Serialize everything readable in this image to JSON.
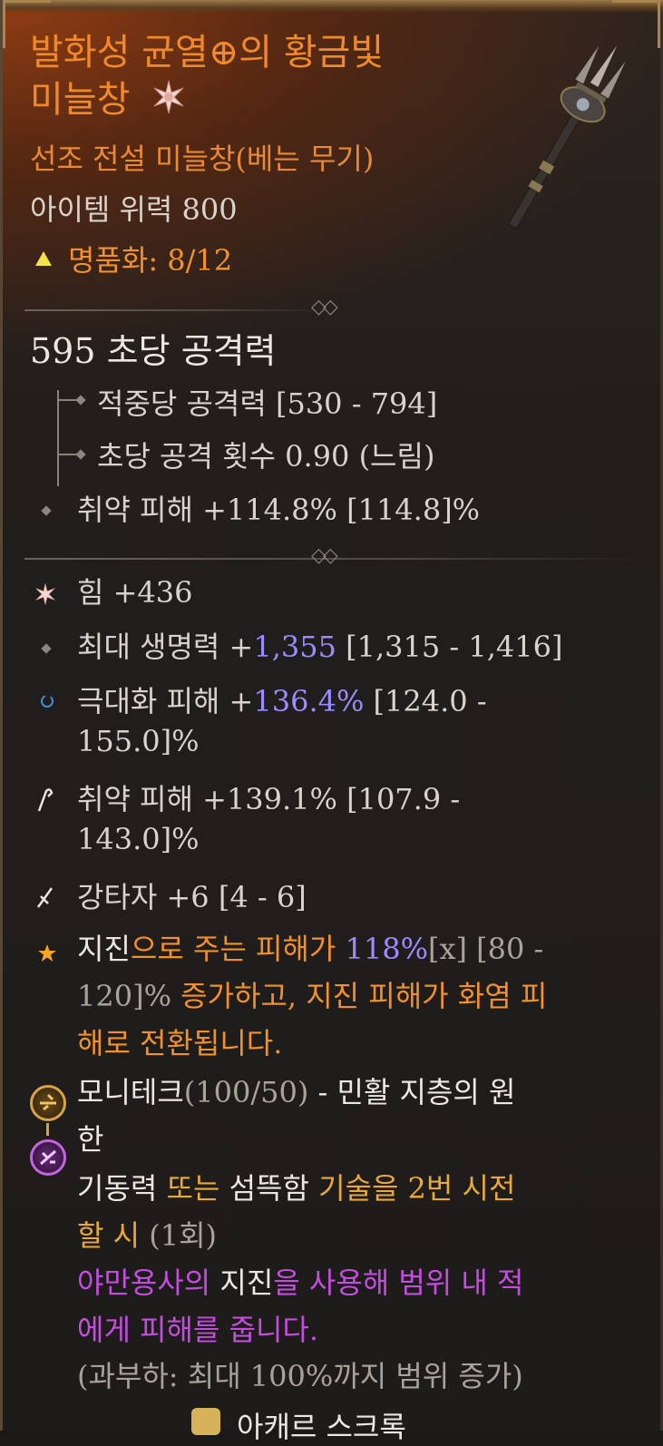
{
  "item": {
    "name_line1": "발화성 균열⊕의 황금빛",
    "name_line2": "미늘창",
    "type": "선조 전설 미늘창(베는 무기)",
    "power": "아이템 위력 800",
    "masterwork_label": "명품화: 8/12"
  },
  "dps": {
    "value": "595 초당 공격력",
    "damage_per_hit": "적중당 공격력 [530 - 794]",
    "attacks_per_second": "초당 공격 횟수 0.90 (느림)",
    "implicit": "취약 피해 +114.8% [114.8]%"
  },
  "affixes": [
    {
      "name": "strength",
      "text": "힘 +436"
    },
    {
      "name": "max-life",
      "prefix": "최대 생명력 +",
      "value": "1,355",
      "suffix": " [1,315 - 1,416]"
    },
    {
      "name": "overpower-damage",
      "prefix": "극대화 피해 +",
      "value": "136.4%",
      "suffix": " [124.0 -",
      "line2": "155.0]%"
    },
    {
      "name": "vulnerable-damage",
      "line1": "취약 피해 +139.1% [107.9 -",
      "line2": "143.0]%"
    },
    {
      "name": "brawler",
      "text": "강타자 +6 [4 - 6]"
    }
  ],
  "aspect": {
    "word1": "지진",
    "text1": "으로 주는 피해가 ",
    "value": "118%",
    "marker": "[x]",
    "text2": " [80 -",
    "line2a": "120]% ",
    "line2b": "증가하고, 지진 피해가 화염 피",
    "line3": "해로 전환됩니다."
  },
  "rune": {
    "title": "모니테크",
    "count": "(100/50)",
    "title_rest": " - 민활 지층의 원",
    "title_line2": "한",
    "cond_a": "기동력 ",
    "cond_b": "또는 ",
    "cond_c": "섬뜩함 ",
    "cond_d": "기술을 2번 시전",
    "cond_line2a": "할 시 ",
    "cond_line2b": "(1회)",
    "eff_a": "야만용사의 ",
    "eff_b": "지진",
    "eff_c": "을 사용해 범위 내 적",
    "eff_line2": "에게 피해를 줍니다.",
    "overflow": "(과부하: 최대 100%까지 범위 증가)"
  },
  "footer": {
    "partial_text": "아캐르 스크록"
  },
  "colors": {
    "legendary_orange": "#f2912c",
    "value_blue": "#9a8cff",
    "rune_purple": "#c24dde",
    "rune_gold": "#e9a93a"
  }
}
